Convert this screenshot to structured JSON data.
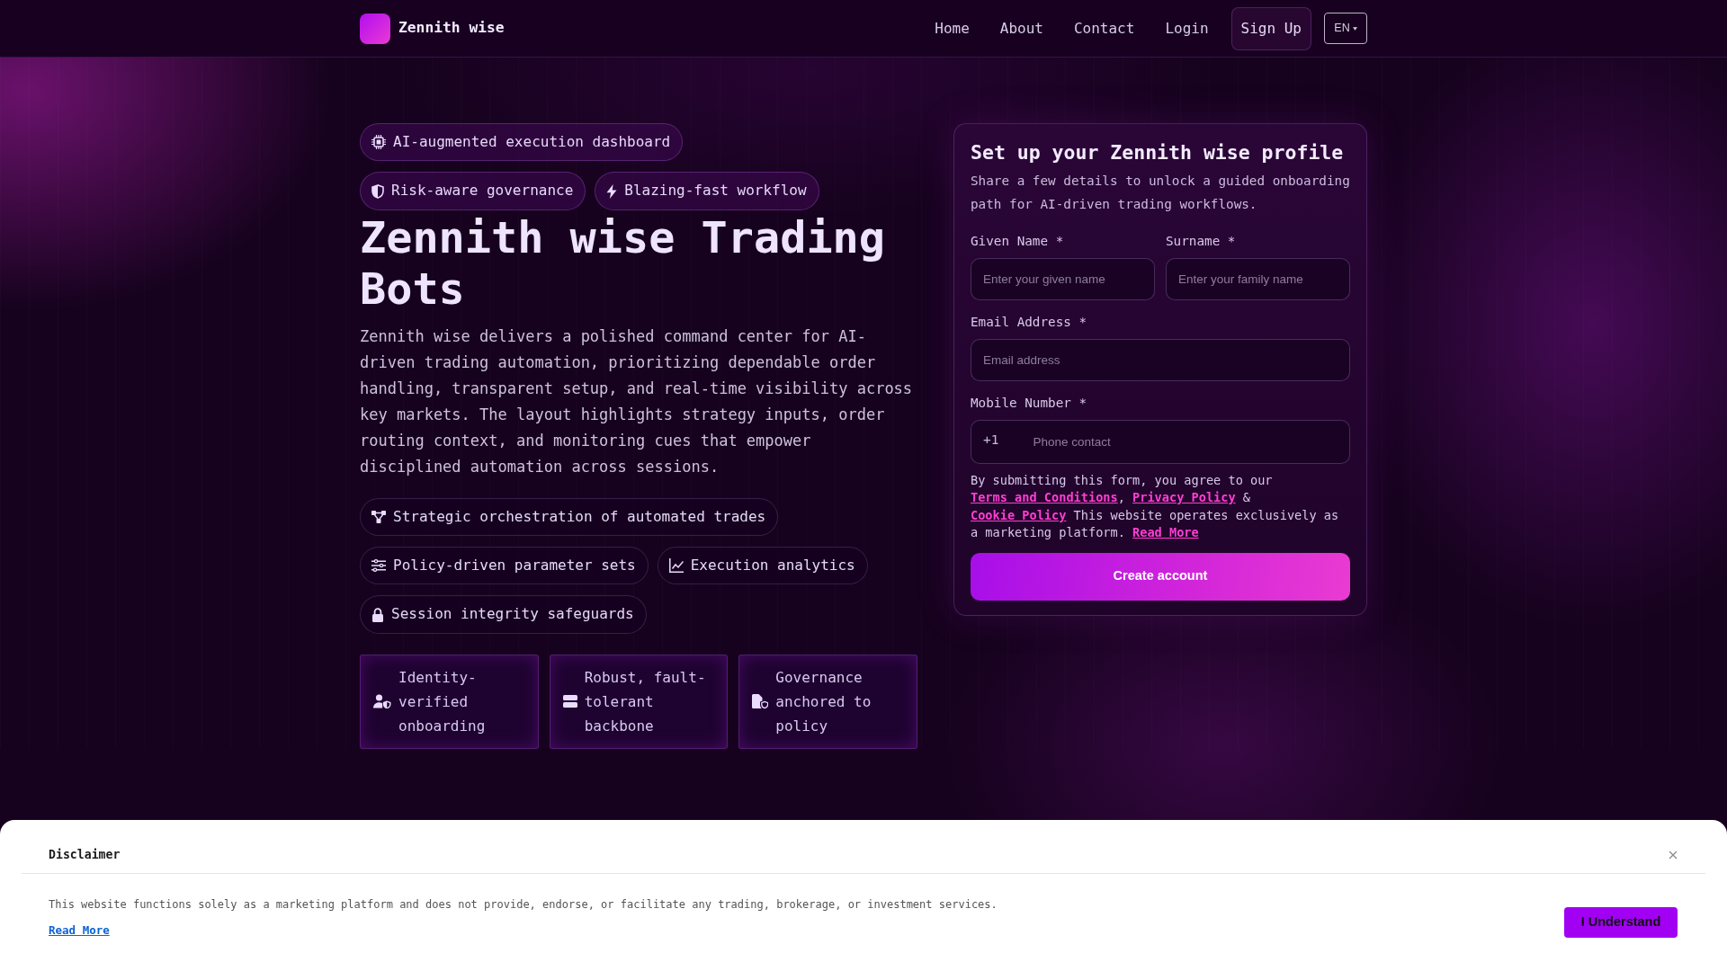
{
  "navbar": {
    "brand": "Zennith wise",
    "links": [
      "Home",
      "About",
      "Contact",
      "Login"
    ],
    "signup": "Sign Up",
    "language": "EN"
  },
  "hero": {
    "eyebrow": {
      "kind": "chip",
      "label": "AI-augmented execution dashboard"
    },
    "badges": [
      {
        "kind": "shield",
        "label": "Risk-aware governance"
      },
      {
        "kind": "bolt",
        "label": "Blazing-fast workflow"
      }
    ],
    "title": "Zennith wise Trading Bots",
    "description": "Zennith wise delivers a polished command center for AI-driven trading automation, prioritizing dependable order handling, transparent setup, and real-time visibility across key markets. The layout highlights strategy inputs, order routing context, and monitoring cues that empower disciplined automation across sessions.",
    "features": [
      {
        "kind": "network",
        "label": "Strategic orchestration of automated trades"
      },
      {
        "kind": "sliders",
        "label": "Policy-driven parameter sets"
      },
      {
        "kind": "chart",
        "label": "Execution analytics"
      },
      {
        "kind": "lock",
        "label": "Session integrity safeguards"
      }
    ],
    "highlights": [
      {
        "kind": "identity",
        "label": "Identity-verified onboarding"
      },
      {
        "kind": "server",
        "label": "Robust, fault-tolerant backbone"
      },
      {
        "kind": "document",
        "label": "Governance anchored to policy"
      }
    ]
  },
  "signup_form": {
    "title": "Set up your Zennith wise profile",
    "subtitle": "Share a few details to unlock a guided onboarding path for AI-driven trading workflows.",
    "name_fields": [
      {
        "label": "Given Name *",
        "placeholder": "Enter your given name"
      },
      {
        "label": "Surname *",
        "placeholder": "Enter your family name"
      }
    ],
    "email_field": {
      "label": "Email Address *",
      "placeholder": "Email address"
    },
    "phone_field": {
      "label": "Mobile Number *",
      "prefix": "+1",
      "placeholder": "Phone contact"
    },
    "consent": [
      {
        "kind": "text",
        "text": "By submitting this form, you agree to our "
      },
      {
        "kind": "link",
        "text": "Terms and Conditions"
      },
      {
        "kind": "text",
        "text": ", "
      },
      {
        "kind": "link",
        "text": "Privacy Policy"
      },
      {
        "kind": "text",
        "text": " & "
      },
      {
        "kind": "link",
        "text": "Cookie Policy"
      },
      {
        "kind": "text",
        "text": " This website operates exclusively as a marketing platform. "
      },
      {
        "kind": "link",
        "text": "Read More"
      }
    ],
    "submit": "Create account"
  },
  "disclaimer": {
    "title": "Disclaimer",
    "body": "This website functions solely as a marketing platform and does not provide, endorse, or facilitate any trading, brokerage, or investment services.",
    "link": "Read More",
    "button": "I Understand"
  }
}
